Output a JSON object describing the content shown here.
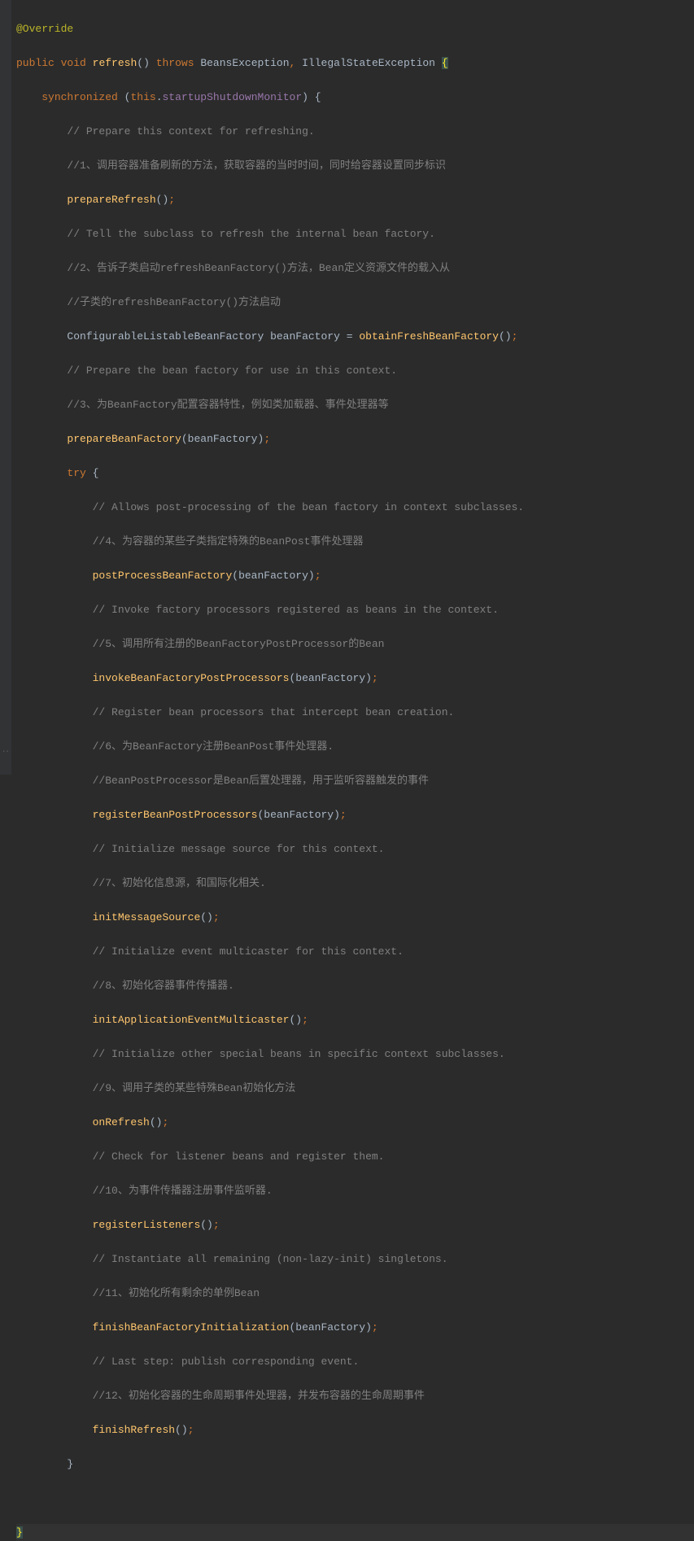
{
  "code": {
    "annotation": "@Override",
    "signature": {
      "public": "public",
      "void": "void",
      "name": "refresh",
      "throws": "throws",
      "ex1": "BeansException",
      "ex2": "IllegalStateException"
    },
    "sync": {
      "synchronized": "synchronized",
      "this": "this",
      "monitor": "startupShutdownMonitor"
    },
    "c1a": "// Prepare this context for refreshing.",
    "c1b": "//1、调用容器准备刷新的方法，获取容器的当时时间，同时给容器设置同步标识",
    "m1": "prepareRefresh",
    "c2a": "// Tell the subclass to refresh the internal bean factory.",
    "c2b": "//2、告诉子类启动refreshBeanFactory()方法，Bean定义资源文件的载入从",
    "c2c": "//子类的refreshBeanFactory()方法启动",
    "obtain_type": "ConfigurableListableBeanFactory",
    "obtain_var": "beanFactory",
    "obtain_method": "obtainFreshBeanFactory",
    "c3a": "// Prepare the bean factory for use in this context.",
    "c3b": "//3、为BeanFactory配置容器特性，例如类加载器、事件处理器等",
    "m3": "prepareBeanFactory",
    "try": "try",
    "c4a": "// Allows post-processing of the bean factory in context subclasses.",
    "c4b": "//4、为容器的某些子类指定特殊的BeanPost事件处理器",
    "m4": "postProcessBeanFactory",
    "c5a": "// Invoke factory processors registered as beans in the context.",
    "c5b": "//5、调用所有注册的BeanFactoryPostProcessor的Bean",
    "m5": "invokeBeanFactoryPostProcessors",
    "c6a": "// Register bean processors that intercept bean creation.",
    "c6b": "//6、为BeanFactory注册BeanPost事件处理器.",
    "c6c": "//BeanPostProcessor是Bean后置处理器，用于监听容器触发的事件",
    "m6": "registerBeanPostProcessors",
    "c7a": "// Initialize message source for this context.",
    "c7b": "//7、初始化信息源，和国际化相关.",
    "m7": "initMessageSource",
    "c8a": "// Initialize event multicaster for this context.",
    "c8b": "//8、初始化容器事件传播器.",
    "m8": "initApplicationEventMulticaster",
    "c9a": "// Initialize other special beans in specific context subclasses.",
    "c9b": "//9、调用子类的某些特殊Bean初始化方法",
    "m9": "onRefresh",
    "c10a": "// Check for listener beans and register them.",
    "c10b": "//10、为事件传播器注册事件监听器.",
    "m10": "registerListeners",
    "c11a": "// Instantiate all remaining (non-lazy-init) singletons.",
    "c11b": "//11、初始化所有剩余的单例Bean",
    "m11": "finishBeanFactoryInitialization",
    "c12a": "// Last step: publish corresponding event.",
    "c12b": "//12、初始化容器的生命周期事件处理器，并发布容器的生命周期事件",
    "m12": "finishRefresh",
    "bf_arg": "beanFactory"
  },
  "gutter_mark": ".."
}
